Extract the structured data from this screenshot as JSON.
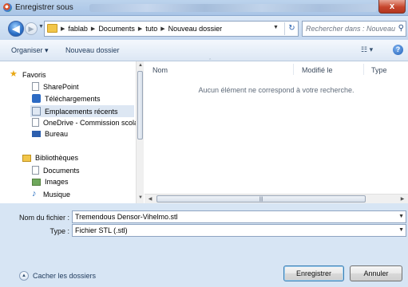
{
  "window": {
    "title": "Enregistrer sous",
    "close_label": "x"
  },
  "nav": {
    "back_icon": "arrow-left",
    "forward_icon": "arrow-right",
    "breadcrumbs": [
      "fablab",
      "Documents",
      "tuto",
      "Nouveau dossier"
    ],
    "search_placeholder": "Rechercher dans : Nouveau do..."
  },
  "toolbar": {
    "organize_label": "Organiser ▾",
    "new_folder_label": "Nouveau dossier",
    "view_label": "☷ ▾",
    "help_label": "?"
  },
  "sidebar": {
    "items": [
      {
        "label": "Favoris",
        "icon": "star-icon"
      },
      {
        "label": "SharePoint",
        "icon": "document-icon"
      },
      {
        "label": "Téléchargements",
        "icon": "downloads-icon"
      },
      {
        "label": "Emplacements récents",
        "icon": "recent-places-icon"
      },
      {
        "label": "OneDrive - Commission scolai",
        "icon": "document-icon"
      },
      {
        "label": "Bureau",
        "icon": "desktop-icon"
      },
      {
        "label": "Bibliothèques",
        "icon": "libraries-icon"
      },
      {
        "label": "Documents",
        "icon": "document-icon"
      },
      {
        "label": "Images",
        "icon": "images-icon"
      },
      {
        "label": "Musique",
        "icon": "music-icon"
      }
    ]
  },
  "file_list": {
    "columns": [
      "Nom",
      "Modifié le",
      "Type"
    ],
    "empty_message": "Aucun élément ne correspond à votre recherche."
  },
  "form": {
    "filename_label": "Nom du fichier :",
    "filename_value": "Tremendous Densor-Vihelmo.stl",
    "type_label": "Type :",
    "type_value": "Fichier STL (.stl)",
    "hide_folders_label": "Cacher les dossiers",
    "save_label": "Enregistrer",
    "cancel_label": "Annuler"
  }
}
